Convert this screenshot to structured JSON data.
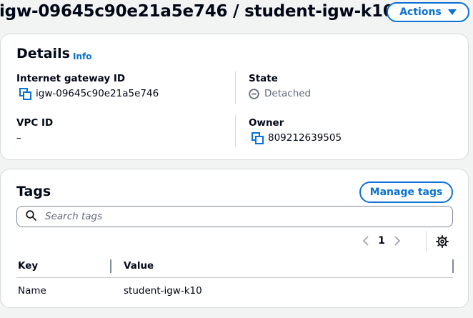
{
  "header": {
    "title": "igw-09645c90e21a5e746 / student-igw-k10",
    "actions_label": "Actions"
  },
  "details": {
    "title": "Details",
    "info_label": "Info",
    "internet_gateway_id_label": "Internet gateway ID",
    "internet_gateway_id_value": "igw-09645c90e21a5e746",
    "state_label": "State",
    "state_value": "Detached",
    "vpc_id_label": "VPC ID",
    "vpc_id_value": "–",
    "owner_label": "Owner",
    "owner_value": "809212639505"
  },
  "tags": {
    "title": "Tags",
    "manage_label": "Manage tags",
    "search_placeholder": "Search tags",
    "page_number": "1",
    "columns": [
      "Key",
      "Value"
    ],
    "rows": [
      {
        "key": "Name",
        "value": "student-igw-k10"
      }
    ]
  },
  "colors": {
    "accent": "#0972d3",
    "background": "#f2f3f3",
    "border": "#d5dbdb",
    "text": "#000716",
    "muted": "#5f6b7a"
  }
}
